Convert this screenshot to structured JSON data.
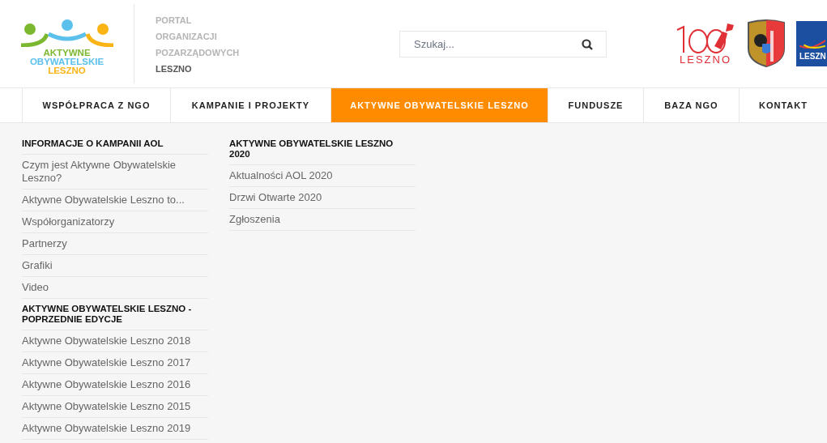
{
  "logo": {
    "lines": [
      {
        "text": "AKTYWNE",
        "color": "#7cb82f"
      },
      {
        "text": "OBYWATELSKIE",
        "color": "#5bc0eb"
      },
      {
        "text": "LESZNO",
        "color": "#fbb416"
      }
    ]
  },
  "portal_title": [
    {
      "text": "PORTAL",
      "kind": "muted"
    },
    {
      "text": "ORGANIZACJI",
      "kind": "muted"
    },
    {
      "text": "POZARZĄDOWYCH",
      "kind": "muted"
    },
    {
      "text": "LESZNO",
      "kind": "strong"
    }
  ],
  "search": {
    "placeholder": "Szukaj..."
  },
  "partner_logos": [
    {
      "kind": "centenary",
      "text": "LESZNO"
    },
    {
      "kind": "crest"
    },
    {
      "kind": "city",
      "text": "LESZN"
    }
  ],
  "nav": [
    {
      "label": "WSPÓŁPRACA Z NGO",
      "selected": false
    },
    {
      "label": "KAMPANIE I PROJEKTY",
      "selected": false
    },
    {
      "label": "AKTYWNE OBYWATELSKIE LESZNO",
      "selected": true
    },
    {
      "label": "FUNDUSZE",
      "selected": false
    },
    {
      "label": "BAZA NGO",
      "selected": false
    },
    {
      "label": "KONTAKT",
      "selected": false
    }
  ],
  "menu": {
    "columns": [
      {
        "sections": [
          {
            "heading": "INFORMACJE O KAMPANII AOL",
            "items": [
              "Czym jest Aktywne Obywatelskie Leszno?",
              "Aktywne Obywatelskie Leszno to...",
              "Współorganizatorzy",
              "Partnerzy",
              "Grafiki",
              "Video"
            ]
          },
          {
            "heading": "AKTYWNE OBYWATELSKIE LESZNO - POPRZEDNIE EDYCJE",
            "items": [
              "Aktywne Obywatelskie Leszno 2018",
              "Aktywne Obywatelskie Leszno 2017",
              "Aktywne Obywatelskie Leszno 2016",
              "Aktywne Obywatelskie Leszno 2015",
              "Aktywne Obywatelskie Leszno 2019"
            ]
          }
        ]
      },
      {
        "sections": [
          {
            "heading": "AKTYWNE OBYWATELSKIE LESZNO 2020",
            "items": [
              "Aktualności AOL 2020",
              "Drzwi Otwarte 2020",
              "Zgłoszenia"
            ]
          }
        ]
      }
    ]
  }
}
